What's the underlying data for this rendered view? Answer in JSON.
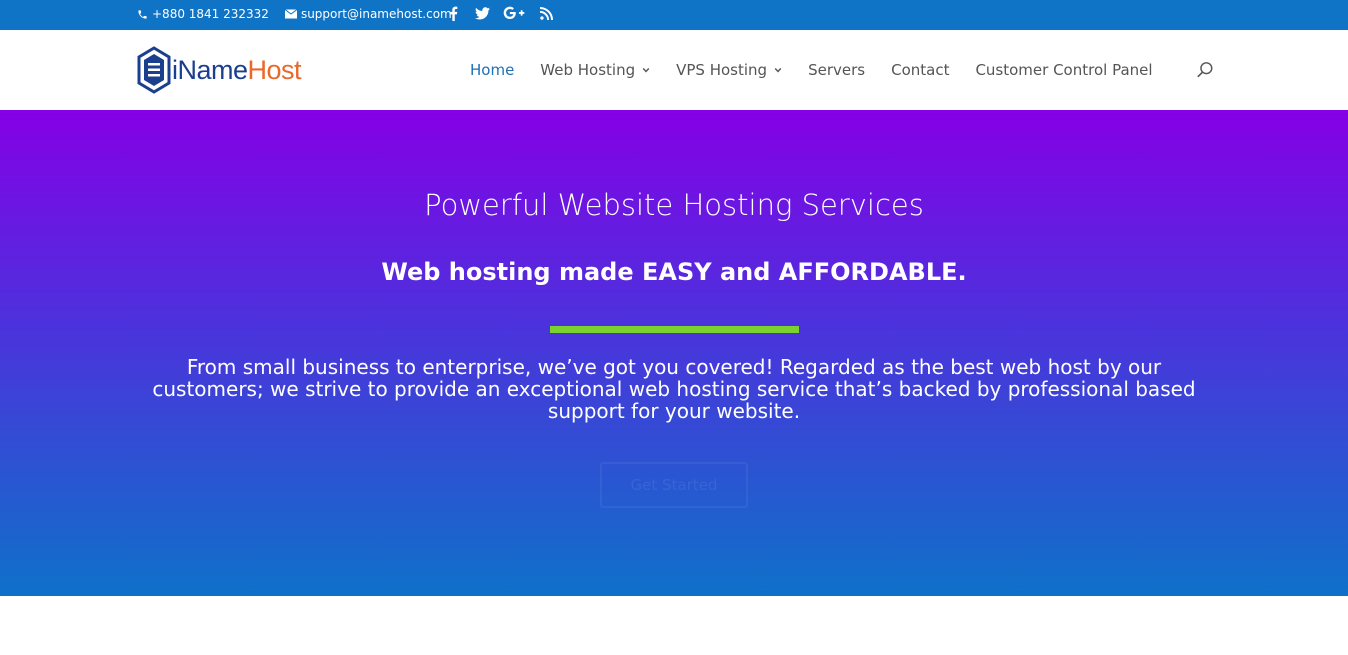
{
  "topbar": {
    "phone": "+880 1841 232332",
    "email": "support@inamehost.com",
    "social": [
      "facebook-icon",
      "twitter-icon",
      "google-plus-icon",
      "rss-icon"
    ]
  },
  "header": {
    "logo_part1": "iName",
    "logo_part2": "Host",
    "nav": [
      {
        "label": "Home"
      },
      {
        "label": "Web Hosting"
      },
      {
        "label": "VPS Hosting"
      },
      {
        "label": "Servers"
      },
      {
        "label": "Contact"
      },
      {
        "label": "Customer Control Panel"
      }
    ]
  },
  "hero": {
    "title": "Powerful Website Hosting Services",
    "subtitle": "Web hosting made EASY and AFFORDABLE.",
    "body": "From small business to enterprise, we’ve got you covered! Regarded as the best web host by our customers; we strive to provide an exceptional web hosting service that’s backed by professional based support for your website.",
    "cta_label": "Get Started"
  },
  "colors": {
    "topbar": "#0f73c6",
    "nav_active": "#1f6fb4",
    "hero_top": "#8500e6",
    "hero_bottom": "#0f71c9",
    "divider": "#7bd12e",
    "logo_blue": "#1b3f8f",
    "logo_orange": "#e8692a"
  }
}
